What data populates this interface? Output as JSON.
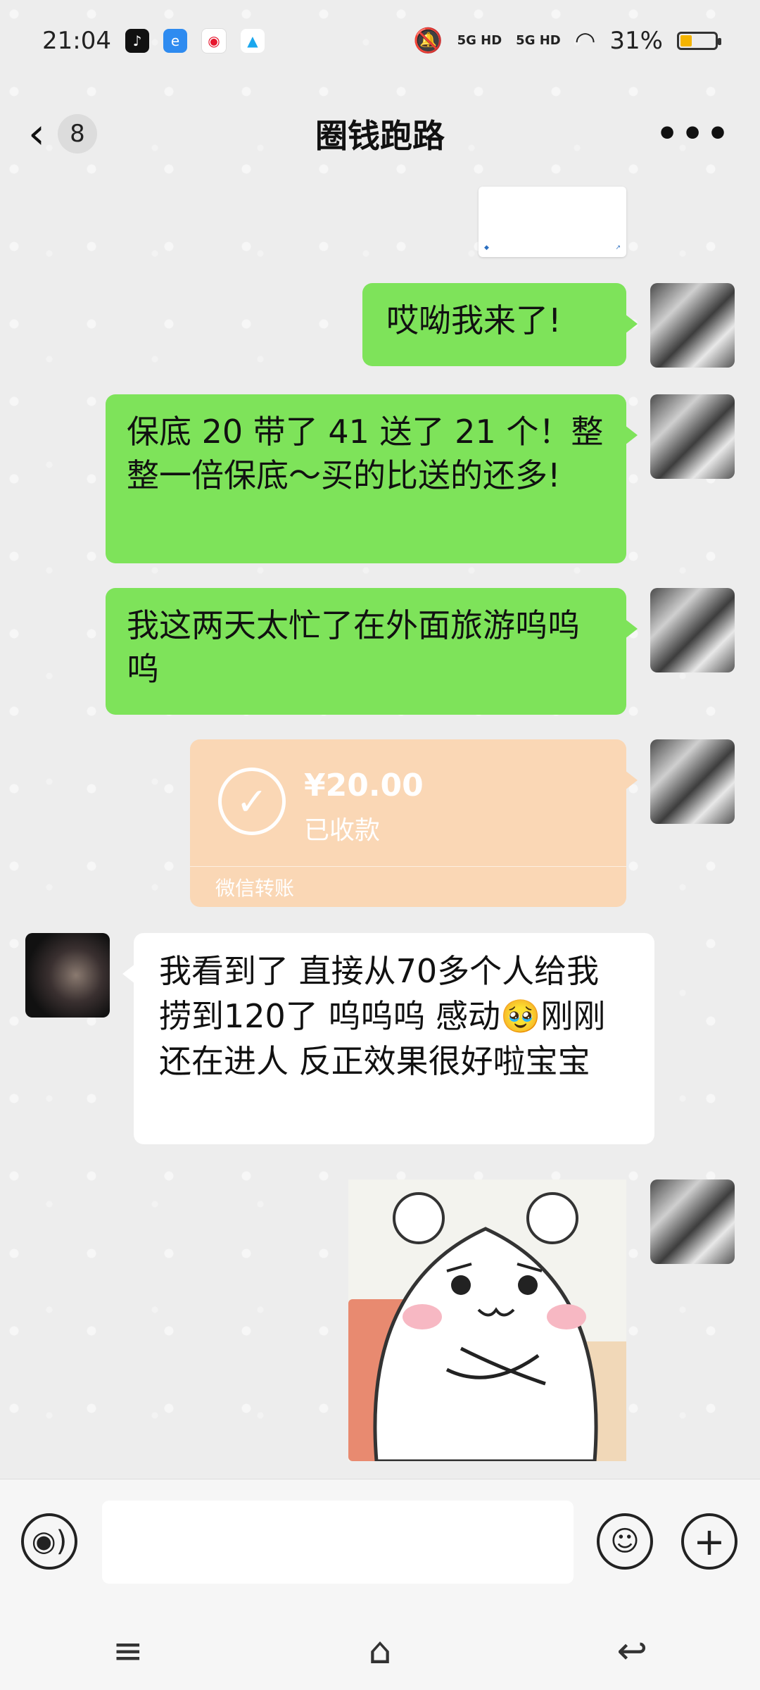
{
  "status_bar": {
    "time": "21:04",
    "net1": "5G HD",
    "net2": "5G HD",
    "battery": "31%"
  },
  "nav": {
    "unread_count": "8",
    "title": "圈钱跑路",
    "more": "•••"
  },
  "messages": [
    {
      "from": "me",
      "text": "哎呦我来了!"
    },
    {
      "from": "me",
      "text": "保底 20 带了 41 送了 21 个！整整一倍保底～买的比送的还多!"
    },
    {
      "from": "me",
      "text": "我这两天太忙了在外面旅游呜呜呜"
    },
    {
      "from": "other",
      "text": "我看到了 直接从70多个人给我捞到120了 呜呜呜 感动🥹刚刚还在进人 反正效果很好啦宝宝"
    }
  ],
  "transfer": {
    "amount": "¥20.00",
    "status": "已收款",
    "label": "微信转账"
  },
  "input": {
    "placeholder": ""
  },
  "icons": {
    "back": "‹",
    "voice": "◉)",
    "emoji": "☺",
    "plus": "+",
    "menu": "≡",
    "home": "⌂",
    "recent": "↩"
  }
}
